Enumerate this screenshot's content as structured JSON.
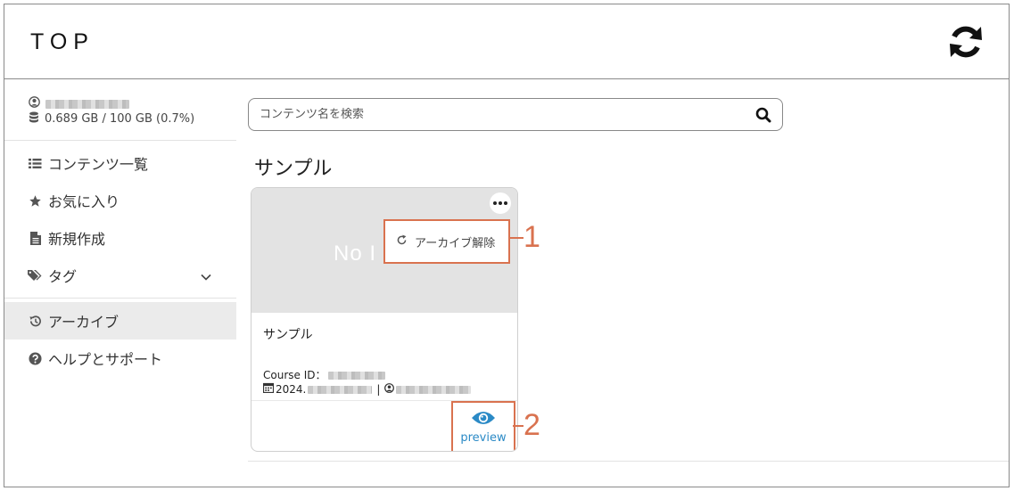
{
  "header": {
    "logo": "TOP",
    "sync_icon": "sync-icon"
  },
  "sidebar": {
    "storage": "0.689 GB / 100 GB (0.7%)",
    "nav": [
      {
        "label": "コンテンツ一覧",
        "icon": "list-icon"
      },
      {
        "label": "お気に入り",
        "icon": "star-icon"
      },
      {
        "label": "新規作成",
        "icon": "file-icon"
      },
      {
        "label": "タグ",
        "icon": "tags-icon"
      },
      {
        "label": "アーカイブ",
        "icon": "history-icon",
        "active": true
      },
      {
        "label": "ヘルプとサポート",
        "icon": "help-icon"
      }
    ]
  },
  "search": {
    "placeholder": "コンテンツ名を検索"
  },
  "section": {
    "title": "サンプル"
  },
  "card": {
    "thumbnail_text": "No I",
    "menu_item": "アーカイブ解除",
    "title": "サンプル",
    "course_id_label": "Course ID：",
    "date_prefix": "2024.",
    "separator": "|",
    "preview_label": "preview"
  },
  "callouts": {
    "one": "1",
    "two": "2"
  },
  "colors": {
    "accent": "#d9724f",
    "link": "#2b8ac6",
    "active_bg": "#ebebeb"
  }
}
